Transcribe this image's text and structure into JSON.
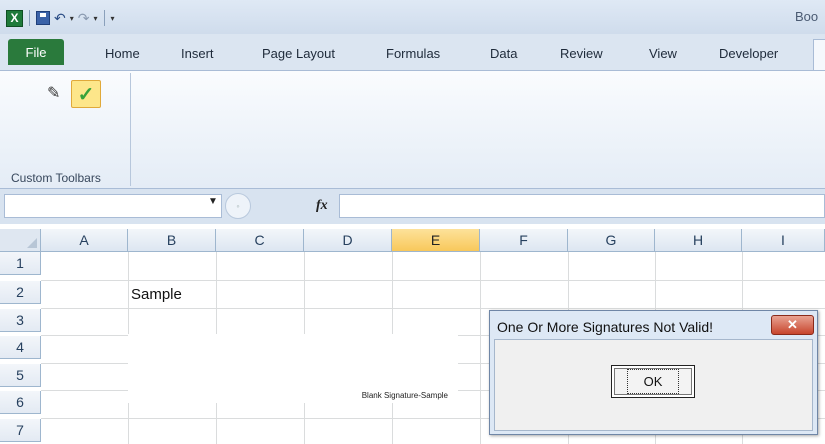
{
  "titlebar": {
    "app_icon": "excel-icon",
    "title_partial": "Boo"
  },
  "ribbon_tabs": [
    "Home",
    "Insert",
    "Page Layout",
    "Formulas",
    "Data",
    "Review",
    "View",
    "Developer"
  ],
  "file_tab": "File",
  "ribbon": {
    "group_label": "Custom Toolbars",
    "buttons": [
      "pencil-icon",
      "checkmark-icon"
    ]
  },
  "formula_bar": {
    "fx_label": "fx",
    "namebox_value": "",
    "formula_value": ""
  },
  "grid": {
    "columns": [
      "A",
      "B",
      "C",
      "D",
      "E",
      "F",
      "G",
      "H",
      "I"
    ],
    "selected_column": "E",
    "rows": [
      "1",
      "2",
      "3",
      "4",
      "5",
      "6",
      "7"
    ],
    "cells": {
      "B2": "Sample"
    },
    "signature_caption": "Blank Signature-Sample"
  },
  "dialog": {
    "title": "One Or More Signatures Not Valid!",
    "close_label": "✕",
    "ok_label": "OK"
  },
  "colors": {
    "file_tab": "#2a7a3c",
    "selected_header": "#f8c85b",
    "dialog_close": "#c7452d"
  }
}
